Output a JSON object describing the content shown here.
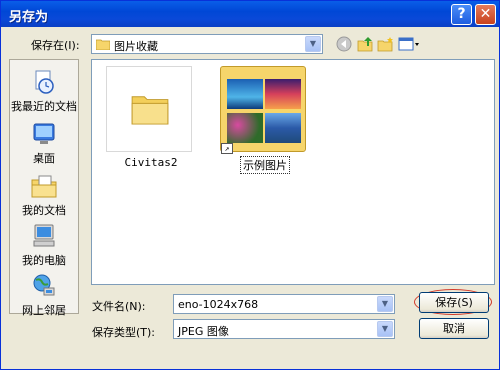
{
  "window": {
    "title": "另存为",
    "help_glyph": "?",
    "close_glyph": "✕"
  },
  "lookin": {
    "label": "保存在(I):",
    "value": "图片收藏"
  },
  "toolbar_icons": [
    "back-icon",
    "up-folder-icon",
    "new-folder-icon",
    "views-menu-icon"
  ],
  "places": [
    {
      "label": "我最近的文档",
      "icon": "recent-documents-icon"
    },
    {
      "label": "桌面",
      "icon": "desktop-icon"
    },
    {
      "label": "我的文档",
      "icon": "my-documents-icon"
    },
    {
      "label": "我的电脑",
      "icon": "my-computer-icon"
    },
    {
      "label": "网上邻居",
      "icon": "network-places-icon"
    }
  ],
  "files": [
    {
      "name": "Civitas2",
      "type": "folder"
    },
    {
      "name": "示例图片",
      "type": "shortcut-folder",
      "selected": true
    }
  ],
  "filename": {
    "label": "文件名(N):",
    "value": "eno-1024x768"
  },
  "filetype": {
    "label": "保存类型(T):",
    "value": "JPEG 图像"
  },
  "buttons": {
    "save": "保存(S)",
    "cancel": "取消"
  },
  "colors": {
    "title_bar": "#0a5ee8",
    "dialog_bg": "#ece9d8",
    "highlight_ring": "#d23a2a"
  }
}
